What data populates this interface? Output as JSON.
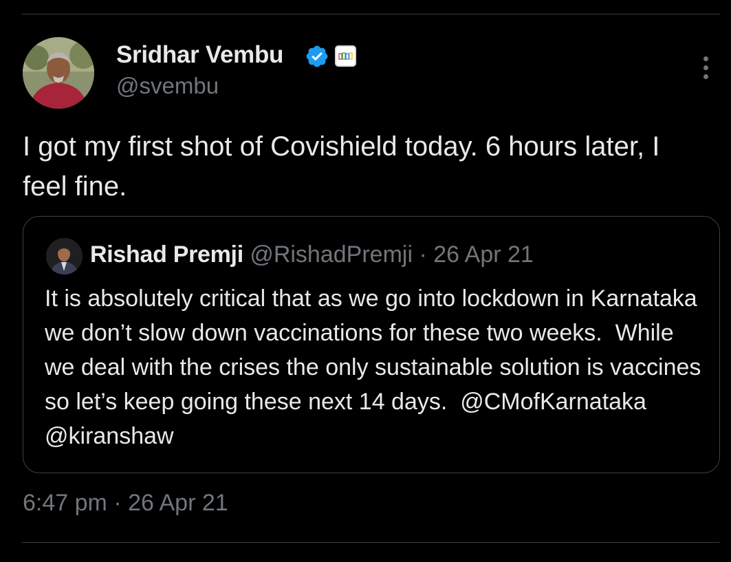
{
  "tweet": {
    "author": {
      "name": "Sridhar Vembu",
      "handle": "@svembu",
      "verified": true,
      "avatar_icon": "profile-photo",
      "affiliate_icon": "zoho-logo"
    },
    "text": "I got my first shot of Covishield today. 6 hours later, I feel fine.",
    "time": "6:47 pm",
    "separator": "·",
    "date": "26 Apr 21"
  },
  "quote": {
    "author": {
      "name": "Rishad Premji",
      "handle": "@RishadPremji",
      "avatar_icon": "profile-photo"
    },
    "separator": "·",
    "date": "26 Apr 21",
    "text": "It is absolutely critical that as we go into lockdown in Karnataka we don’t slow down vaccinations for these two weeks.  While we deal with the crises the only sustainable solution is vaccines so let’s keep going these next 14 days.  @CMofKarnataka @kiranshaw"
  },
  "colors": {
    "background": "#000000",
    "primary_text": "#e7e9ea",
    "secondary_text": "#71767b",
    "border": "#3e4144",
    "verified_blue": "#1d9bf0"
  },
  "icons": {
    "more": "more-options-icon",
    "verified": "verified-badge-icon"
  }
}
